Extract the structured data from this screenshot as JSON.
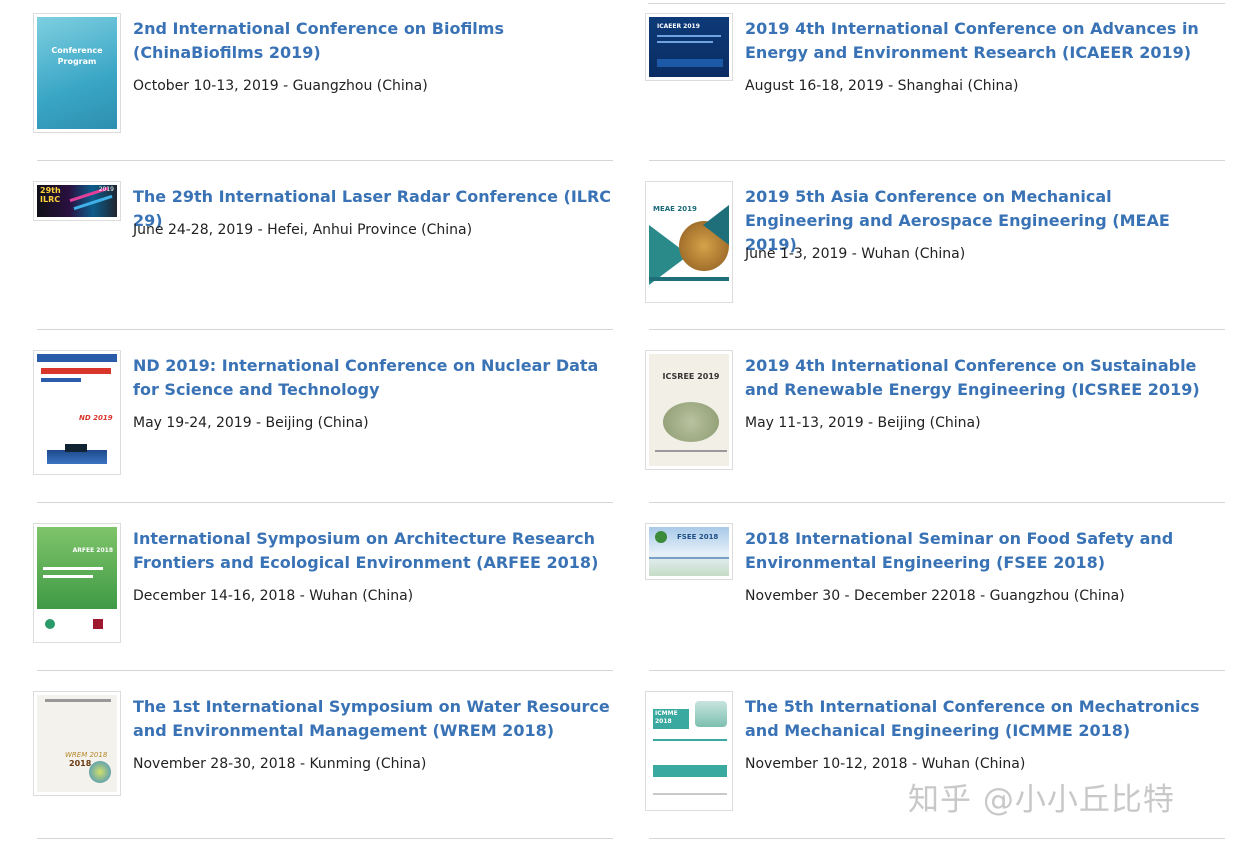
{
  "conferences": [
    {
      "title": "2nd International Conference on Biofilms (ChinaBiofilms 2019)",
      "date": "October 10-13, 2019 - Guangzhou (China)",
      "thumb_text": [
        "Conference",
        "Program"
      ]
    },
    {
      "title": "2019 4th International Conference on Advances in Energy and Environment Research (ICAEER 2019)",
      "date": "August 16-18, 2019 - Shanghai (China)",
      "thumb_text": [
        "ICAEER 2019"
      ]
    },
    {
      "title": "The 29th International Laser Radar Conference (ILRC 29)",
      "date": "June 24-28, 2019 - Hefei, Anhui Province (China)",
      "thumb_text": [
        "29th",
        "ILRC",
        "2019"
      ]
    },
    {
      "title": "2019 5th Asia Conference on Mechanical Engineering and Aerospace Engineering (MEAE 2019)",
      "date": "June 1-3, 2019 - Wuhan (China)",
      "thumb_text": [
        "MEAE 2019"
      ]
    },
    {
      "title": "ND 2019: International Conference on Nuclear Data for Science and Technology",
      "date": "May 19-24, 2019 - Beijing (China)",
      "thumb_text": [
        "ND 2019"
      ]
    },
    {
      "title": "2019 4th International Conference on Sustainable and Renewable Energy Engineering (ICSREE 2019)",
      "date": "May 11-13, 2019 - Beijing (China)",
      "thumb_text": [
        "ICSREE 2019"
      ]
    },
    {
      "title": "International Symposium on Architecture Research Frontiers and Ecological Environment (ARFEE 2018)",
      "date": "December 14-16, 2018 - Wuhan (China)",
      "thumb_text": [
        "ARFEE 2018"
      ]
    },
    {
      "title": "2018 International Seminar on Food Safety and Environmental Engineering (FSEE 2018)",
      "date": "November 30 - December 22018 - Guangzhou (China)",
      "thumb_text": [
        "FSEE 2018"
      ]
    },
    {
      "title": "The 1st International Symposium on Water Resource and Environmental Management (WREM 2018)",
      "date": "November 28-30, 2018 - Kunming (China)",
      "thumb_text": [
        "WREM 2018",
        "2018"
      ]
    },
    {
      "title": "The 5th International Conference on Mechatronics and Mechanical Engineering (ICMME 2018)",
      "date": "November 10-12, 2018 - Wuhan (China)",
      "thumb_text": [
        "ICMME",
        "2018"
      ]
    }
  ],
  "watermark": "知乎 @小小丘比特",
  "colors": {
    "title_link": "#3a73b5",
    "date_text": "#222222",
    "divider": "#d6d6d6"
  }
}
